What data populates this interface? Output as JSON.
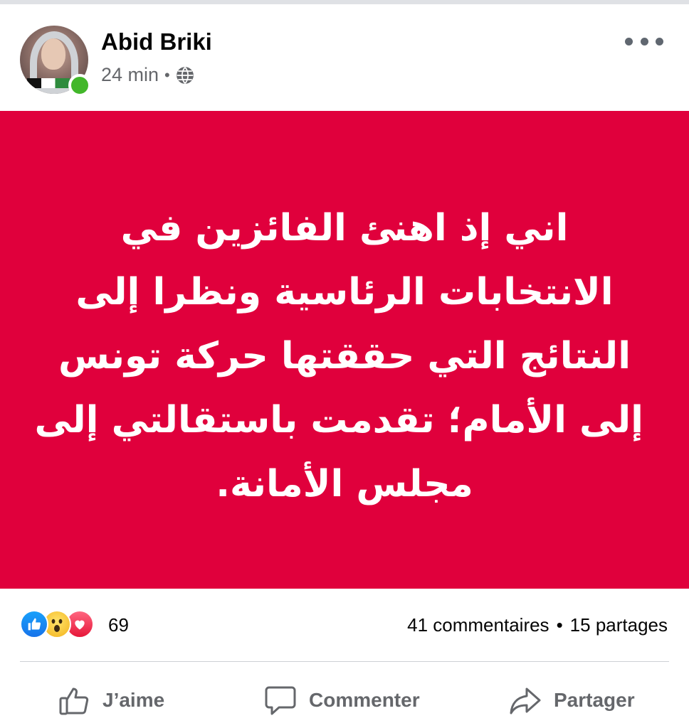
{
  "post": {
    "author": "Abid Briki",
    "time": "24 min",
    "separator": "•",
    "privacy_icon": "globe-icon",
    "more_icon": "more-options-icon",
    "background_color": "#e0003c",
    "text_lines": [
      "اني إذ اهنئ الفائزين في",
      "الانتخابات الرئاسية ونظرا إلى",
      "النتائج التي حققتها حركة تونس",
      "إلى الأمام؛ تقدمت باستقالتي إلى",
      "مجلس الأمانة."
    ]
  },
  "engagement": {
    "reaction_icons": [
      "like-reaction-icon",
      "wow-reaction-icon",
      "love-reaction-icon"
    ],
    "reaction_count": "69",
    "comments": "41 commentaires",
    "separator": "•",
    "shares": "15 partages"
  },
  "actions": {
    "like_label": "J’aime",
    "comment_label": "Commenter",
    "share_label": "Partager"
  },
  "colors": {
    "accent": "#1773ea",
    "muted_text": "#65676b",
    "online": "#42b72a"
  }
}
